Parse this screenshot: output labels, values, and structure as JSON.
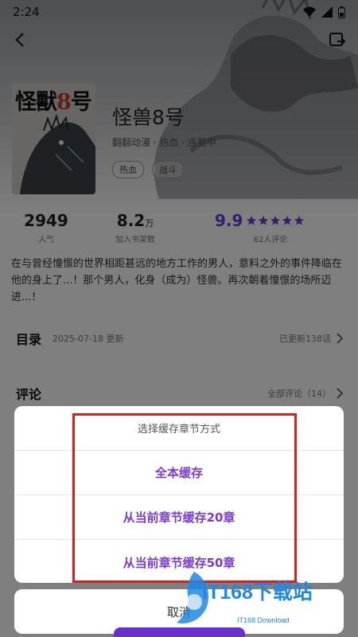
{
  "status_bar": {
    "time": "2:24",
    "icons": [
      "wifi-icon",
      "signal-icon",
      "battery-icon"
    ]
  },
  "topbar": {
    "back_icon": "chevron-left-icon",
    "share_icon": "share-icon"
  },
  "cover": {
    "title_black": "怪獸",
    "title_red": "8",
    "title_tail": "号"
  },
  "book": {
    "title": "怪兽8号",
    "meta": "翻翻动漫 · 热血 · 连载中",
    "tags": [
      "热血",
      "战斗"
    ]
  },
  "stats": {
    "popularity": {
      "value": "2949",
      "label": "人气"
    },
    "shelf": {
      "value": "8.2",
      "unit": "万",
      "label": "加入书架数"
    },
    "score": {
      "value": "9.9",
      "stars": 5,
      "label": "62人评论"
    }
  },
  "description": "在与曾经憧憬的世界相距甚远的地方工作的男人，意料之外的事件降临在他的身上了...！那个男人，化身（成为）怪兽。再次朝着憧憬的场所迈进...！",
  "toc": {
    "title": "目录",
    "updated": "2025-07-18 更新",
    "right": "已更新138话"
  },
  "comments": {
    "title": "评论",
    "right": "全部评论（14）"
  },
  "dialog": {
    "title": "选择缓存章节方式",
    "options": [
      "全本缓存",
      "从当前章节缓存20章",
      "从当前章节缓存50章"
    ],
    "cancel": "取消"
  },
  "colors": {
    "accent": "#7a3ad6",
    "score": "#6a3fd6",
    "highlight": "#d82020"
  },
  "watermark": {
    "text": "IT168下载站",
    "sub": "IT168 Download"
  }
}
